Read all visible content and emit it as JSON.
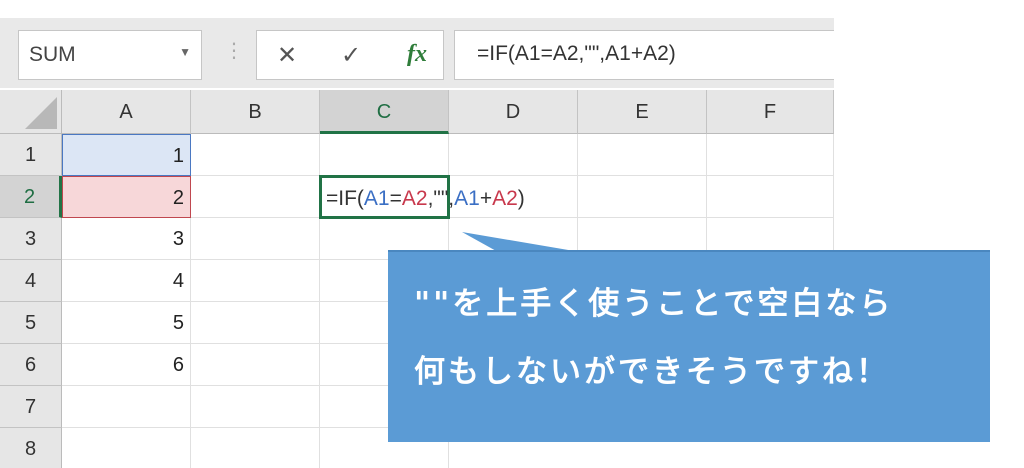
{
  "formula_bar": {
    "name_box": "SUM",
    "name_box_arrow": "▼",
    "separator": "⋮",
    "cancel": "✕",
    "enter": "✓",
    "fx": "fx",
    "formula": "=IF(A1=A2,\"\",A1+A2)"
  },
  "columns": [
    "A",
    "B",
    "C",
    "D",
    "E",
    "F"
  ],
  "rows": [
    "1",
    "2",
    "3",
    "4",
    "5",
    "6",
    "7",
    "8"
  ],
  "cells": {
    "A1": "1",
    "A2": "2",
    "A3": "3",
    "A4": "4",
    "A5": "5",
    "A6": "6"
  },
  "active_cell": {
    "tokens": [
      "=IF(",
      "A1",
      "=",
      "A2",
      ",\"\",",
      "A1",
      "+",
      "A2",
      ")"
    ]
  },
  "callout": {
    "line1": "\"\"を上手く使うことで空白なら",
    "line2": "何もしないができそうですね！"
  },
  "colors": {
    "ref_blue": "#3b6fc4",
    "ref_red": "#c8384c",
    "active_green": "#217346",
    "callout_bg": "#5b9bd5"
  }
}
